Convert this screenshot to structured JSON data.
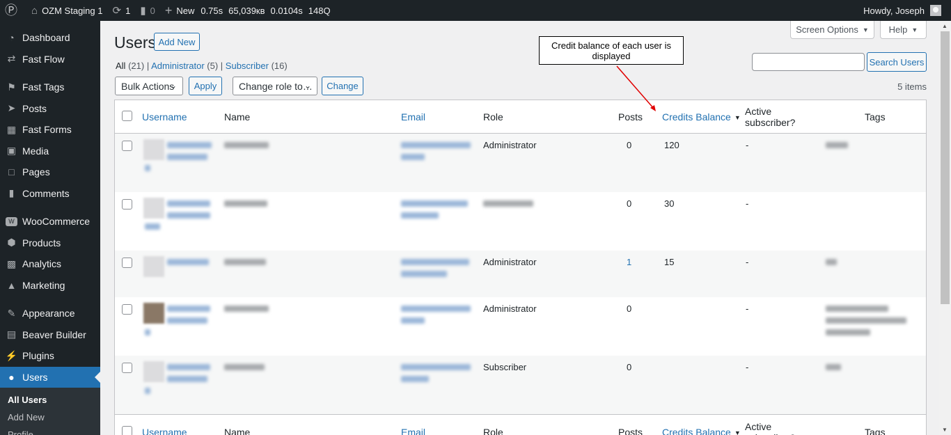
{
  "admin_bar": {
    "site_name": "OZM Staging 1",
    "updates_count": "1",
    "comments_count": "0",
    "new_label": "New",
    "stat_time": "0.75s",
    "stat_memory": "65,039кв",
    "stat_query_time": "0.0104s",
    "stat_queries": "148Q",
    "greeting": "Howdy, Joseph"
  },
  "sidebar": {
    "items": [
      {
        "label": "Dashboard",
        "icon": "dashboard-icon"
      },
      {
        "label": "Fast Flow",
        "icon": "shuffle-icon"
      },
      {
        "label": "Fast Tags",
        "icon": "tag-icon"
      },
      {
        "label": "Posts",
        "icon": "pin-icon"
      },
      {
        "label": "Fast Forms",
        "icon": "grid-icon"
      },
      {
        "label": "Media",
        "icon": "media-icon"
      },
      {
        "label": "Pages",
        "icon": "page-icon"
      },
      {
        "label": "Comments",
        "icon": "comment-icon"
      },
      {
        "label": "WooCommerce",
        "icon": "woo-icon"
      },
      {
        "label": "Products",
        "icon": "box-icon"
      },
      {
        "label": "Analytics",
        "icon": "bar-chart-icon"
      },
      {
        "label": "Marketing",
        "icon": "megaphone-icon"
      },
      {
        "label": "Appearance",
        "icon": "brush-icon"
      },
      {
        "label": "Beaver Builder",
        "icon": "layout-icon"
      },
      {
        "label": "Plugins",
        "icon": "plug-icon"
      },
      {
        "label": "Users",
        "icon": "user-icon"
      }
    ],
    "submenu": [
      "All Users",
      "Add New",
      "Profile"
    ]
  },
  "page": {
    "title": "Users",
    "add_new": "Add New",
    "screen_options": "Screen Options",
    "help": "Help",
    "filter_all": "All",
    "filter_all_count": "(21)",
    "filter_admin": "Administrator",
    "filter_admin_count": "(5)",
    "filter_sub": "Subscriber",
    "filter_sub_count": "(16)",
    "bulk_actions": "Bulk Actions",
    "apply": "Apply",
    "change_role": "Change role to…",
    "change": "Change",
    "search_button": "Search Users",
    "items_count": "5 items"
  },
  "callout": {
    "text": "Credit balance of each user is displayed"
  },
  "table": {
    "headers": {
      "username": "Username",
      "name": "Name",
      "email": "Email",
      "role": "Role",
      "posts": "Posts",
      "credits": "Credits Balance",
      "active": "Active subscriber?",
      "tags": "Tags"
    },
    "rows": [
      {
        "role": "Administrator",
        "posts": "0",
        "credits": "120",
        "active": "-"
      },
      {
        "role": "",
        "posts": "0",
        "credits": "30",
        "active": "-"
      },
      {
        "role": "Administrator",
        "posts": "1",
        "credits": "15",
        "active": "-"
      },
      {
        "role": "Administrator",
        "posts": "0",
        "credits": "",
        "active": "-"
      },
      {
        "role": "Subscriber",
        "posts": "0",
        "credits": "",
        "active": "-"
      }
    ]
  },
  "colors": {
    "admin_bar_bg": "#1d2327",
    "link": "#2271b1",
    "callout_arrow": "#e00000"
  }
}
